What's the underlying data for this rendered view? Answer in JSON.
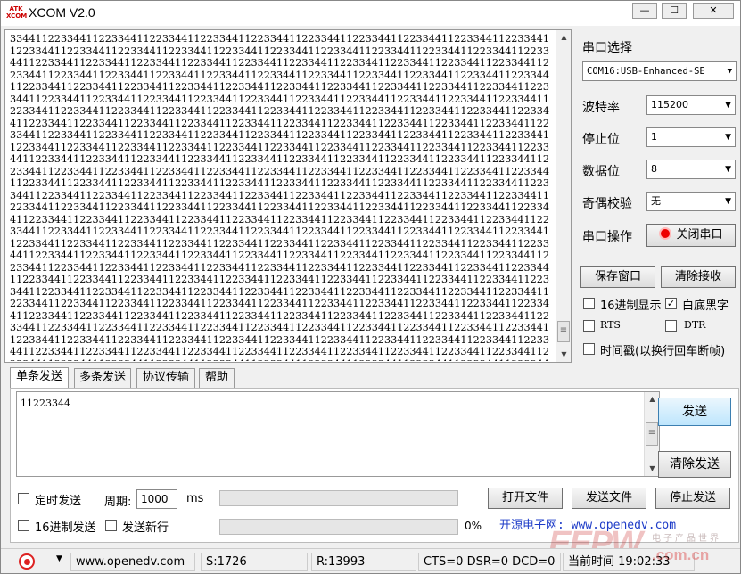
{
  "window": {
    "title": "XCOM V2.0",
    "logo_text": "ATK\nXCOM"
  },
  "receive": {
    "text": "33441122334411223344112233441122334411223344112233441122334411223344112233441122334411223344112233441122334411223344112233441122334411223344112233441122334411223344112233441122334411223344112233441122334411223344112233441122334411223344112233441122334411223344112233441122334411223344112233441122334411223344112233441122334411223344112233441122334411223344112233441122334411223344112233441122334411223344112233441122334411223344112233441122334411223344112233441122334411223344112233441122334411223344112233441122334411223344112233441122334411223344112233441122334411223344112233441122334411223344112233441122334411223344112233441122334411223344112233441122334411223344112233441122334411223344112233441122334411223344112233441122334411223344112233441122334411223344112233441122334411223344112233441122334411223344112233441122334411223344112233441122334411223344112233441122334411223344112233441122334411223344112233441122334411223344112233441122334411223344112233441122334411223344112233441122334411223344112233441122334411223344112233441122334411223344112233441122334411223344112233441122334411223344112233441122334411223344112233441122334411223344112233441122334411223344112233441122334411223344112233441122334411223344112233441122334411223344112233441122334411223344112233441122334411223344112233441122334411223344112233441122334411223344112233441122334411223344112233441122334411223344112233441122334411223344112233441122334411223344112233441122334411223344112233441122334411223344112233441122334411223344112233441122334411223344112233441122334411223344112233441122334411223344112233441122334411223344112233441122334411223344112233441122334411223344112233441122334411223344112233441122334411223344112233441122334411223344112233441122334411223344112233441122334411223344112233441122334411223344112233441122334411223344112233441122334411223344112233441122334411223344112233441122334411223344112233441122334411223344112233441122334411223344112233441122334411223344112233441122334411223344112233441122334411223344112233441122334411223344112233441122334411223344112233441122334411223344112233441122334411223344112233441122334411223344112233441122334411223344112233441122334411223344112233441122334411223344112233441122334411223344112233441122334411223344112233441122334411223344112233441122334411223344112233441122334411223344112233441122334411223344112233441122334411223344112233441122334411223344112233441122334411223344112233441122334411223344112233441122334411223344112233441122334411223344112233441122334411223344112233441122334411223344112233441122334411223344112233441122334411223344112233441122334411223344112233441122334411223344112233441122334411223344112233441122334411223344112233441122334411223344112233441122334411223344112233441122334411223344112233441122334411223344112233441122334411223344112233441122334411223344112233441122334411223344112233441122334411223344112233441122334411223344112233441122334411223344112233441122334411223344112233441122334411223344112233441122334411223344112233441122334411223344112233441122334411223344112233441122334411223344112233441122334411223344112233441122334411223344112233441122334411223344112233441122334411223344"
  },
  "settings": {
    "port_label": "串口选择",
    "port_value": "COM16:USB-Enhanced-SE",
    "baud_label": "波特率",
    "baud_value": "115200",
    "stop_label": "停止位",
    "stop_value": "1",
    "data_label": "数据位",
    "data_value": "8",
    "parity_label": "奇偶校验",
    "parity_value": "无",
    "op_label": "串口操作",
    "op_button": "关闭串口",
    "save_button": "保存窗口",
    "clear_recv_button": "清除接收",
    "hex_display": "16进制显示",
    "hex_display_checked": false,
    "white_black": "白底黑字",
    "white_black_checked": true,
    "rts": "RTS",
    "dtr": "DTR",
    "timestamp": "时间戳(以换行回车断帧)"
  },
  "tabs": [
    "单条发送",
    "多条发送",
    "协议传输",
    "帮助"
  ],
  "send": {
    "text": "11223344",
    "send_button": "发送",
    "clear_send_button": "清除发送",
    "timed_send": "定时发送",
    "period_label": "周期:",
    "period_value": "1000",
    "period_unit": "ms",
    "open_file": "打开文件",
    "send_file": "发送文件",
    "stop_send": "停止发送",
    "hex_send": "16进制发送",
    "newline": "发送新行",
    "progress": "0%",
    "link": "开源电子网: www.openedv.com"
  },
  "status": {
    "site": "www.openedv.com",
    "sent": "S:1726",
    "recv": "R:13993",
    "lines": "CTS=0 DSR=0 DCD=0",
    "time": "当前时间 19:02:33"
  },
  "watermark": {
    "logo": "EEPW",
    "url": ".com.cn",
    "slogan": "电子产品世界"
  }
}
